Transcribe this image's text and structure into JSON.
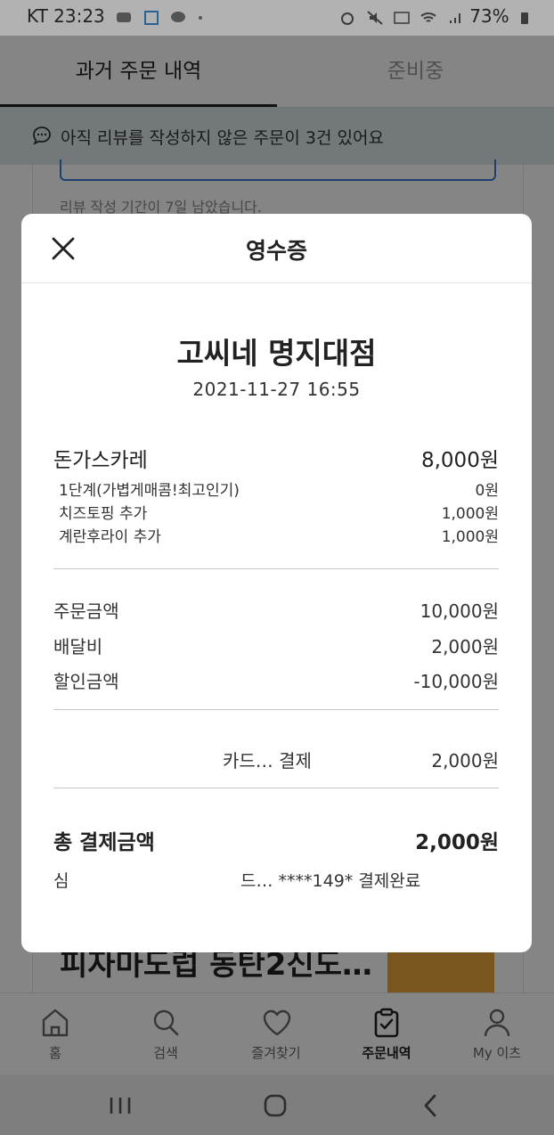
{
  "status_bar": {
    "carrier": "KT",
    "time": "23:23",
    "battery": "73%"
  },
  "tabs": [
    {
      "label": "과거 주문 내역",
      "active": true
    },
    {
      "label": "준비중",
      "active": false
    }
  ],
  "banner": {
    "text": "아직 리뷰를 작성하지 않은 주문이 3건 있어요"
  },
  "background_list": {
    "review_note": "리뷰 작성 기간이 7일 남았습니다.",
    "next_store_partial": "피자마도럽 동탄2신도…"
  },
  "receipt": {
    "title": "영수증",
    "store_name": "고씨네 명지대점",
    "order_datetime": "2021-11-27 16:55",
    "item": {
      "name": "돈가스카레",
      "price": "8,000원"
    },
    "options": [
      {
        "name": "1단계(가볍게매콤!최고인기)",
        "price": "0원"
      },
      {
        "name": "치즈토핑 추가",
        "price": "1,000원"
      },
      {
        "name": "계란후라이 추가",
        "price": "1,000원"
      }
    ],
    "summary": [
      {
        "label": "주문금액",
        "value": "10,000원"
      },
      {
        "label": "배달비",
        "value": "2,000원"
      },
      {
        "label": "할인금액",
        "value": "-10,000원"
      }
    ],
    "payment": {
      "label": "카드… 결제",
      "value": "2,000원"
    },
    "total": {
      "label": "총 결제금액",
      "value": "2,000원"
    },
    "payment_status": {
      "left": "심",
      "right": "드… ****149* 결제완료"
    }
  },
  "bottom_nav": [
    {
      "label": "홈",
      "icon": "home-icon",
      "active": false
    },
    {
      "label": "검색",
      "icon": "search-icon",
      "active": false
    },
    {
      "label": "즐겨찾기",
      "icon": "heart-icon",
      "active": false
    },
    {
      "label": "주문내역",
      "icon": "clipboard-check-icon",
      "active": true
    },
    {
      "label": "My 이츠",
      "icon": "person-icon",
      "active": false
    }
  ],
  "system_nav": [
    "recent-apps-icon",
    "home-circle-icon",
    "back-icon"
  ]
}
